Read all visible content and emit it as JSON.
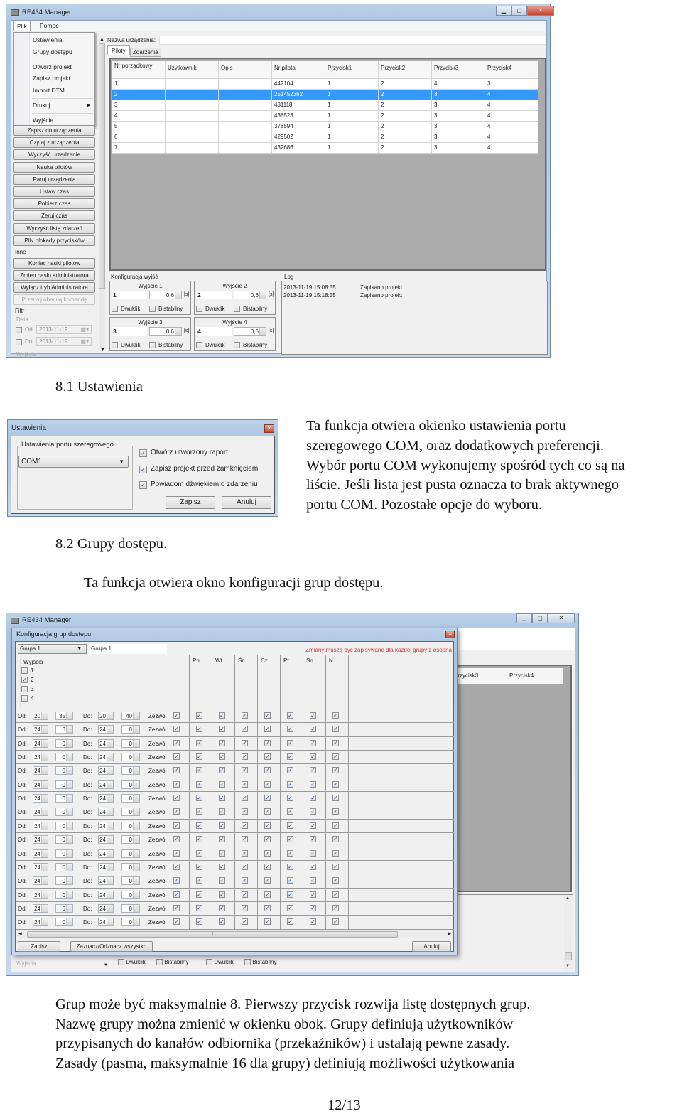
{
  "screen1": {
    "title": "RE434 Manager",
    "menu": [
      "Plik",
      "Pomoc"
    ],
    "dropdown": [
      {
        "label": "Ustawienia"
      },
      {
        "label": "Grupy dostępu"
      },
      {
        "label": "Otworz projekt"
      },
      {
        "label": "Zapisz projekt"
      },
      {
        "label": "Import DTM"
      },
      {
        "label": "Drukuj",
        "submenu": true
      },
      {
        "label": "Wyjście"
      }
    ],
    "left_buttons": [
      "Zapisz do urządzenia",
      "Czytaj z urządzenia",
      "Wyczyść urządzenie",
      "Nauka pilotów",
      "Paruj urządzenia",
      "Ustaw czas",
      "Pobierz czas",
      "Zeruj czas",
      "Wyczyść listę zdarzeń",
      "PIN blokady przycisków"
    ],
    "inne_label": "Inne",
    "inne_buttons": [
      "Koniec nauki pilotów",
      "Zmien hasło administratora",
      "Wyłącz tryb Administratora"
    ],
    "disabled_button": "Przerwij obecną komendę",
    "filter": {
      "label": "Filtr",
      "data_label": "Data",
      "od_label": "Od",
      "od_value": "2013-11-19",
      "do_label": "Do",
      "do_value": "2013-11-19",
      "wyjscia_label": "Wyjścia"
    },
    "device_name_label": "Nazwa urządzenia:",
    "device_name_value": "",
    "tabs": [
      "Piloty",
      "Zdarzenia"
    ],
    "active_tab": "Piloty",
    "grid": {
      "headers": [
        "Nr porządkowy",
        "Użytkownik",
        "Opis",
        "Nr pilota",
        "Przycisk1",
        "Przycisk2",
        "Przycisk3",
        "Przycisk4"
      ],
      "selected_row": 2,
      "rows": [
        [
          "1",
          "",
          "",
          "442104",
          "1",
          "2",
          "4",
          "3"
        ],
        [
          "2",
          "",
          "",
          "251452362",
          "1",
          "2",
          "3",
          "4"
        ],
        [
          "3",
          "",
          "",
          "431118",
          "1",
          "2",
          "3",
          "4"
        ],
        [
          "4",
          "",
          "",
          "438523",
          "1",
          "2",
          "3",
          "4"
        ],
        [
          "5",
          "",
          "",
          "378594",
          "1",
          "2",
          "3",
          "4"
        ],
        [
          "6",
          "",
          "",
          "429502",
          "1",
          "2",
          "3",
          "4"
        ],
        [
          "7",
          "",
          "",
          "432686",
          "1",
          "2",
          "3",
          "4"
        ]
      ]
    },
    "outputs_label": "Konfiguracja wyjść",
    "outputs": [
      {
        "title": "Wyjście 1",
        "value": "1",
        "time": "0,6",
        "unit": "[s]",
        "dwuklik": "Dwuklik",
        "bistabilny": "Bistabilny"
      },
      {
        "title": "Wyjście 2",
        "value": "2",
        "time": "0,6",
        "unit": "[s]",
        "dwuklik": "Dwuklik",
        "bistabilny": "Bistabilny"
      },
      {
        "title": "Wyjście 3",
        "value": "3",
        "time": "0,6",
        "unit": "[s]",
        "dwuklik": "Dwuklik",
        "bistabilny": "Bistabilny"
      },
      {
        "title": "Wyjście 4",
        "value": "4",
        "time": "0,6",
        "unit": "[s]",
        "dwuklik": "Dwuklik",
        "bistabilny": "Bistabilny"
      }
    ],
    "log_label": "Log",
    "log": [
      {
        "time": "2013-11-19 15:08:55",
        "msg": "Zapisano projekt"
      },
      {
        "time": "2013-11-19 15:18:55",
        "msg": "Zapisano projekt"
      }
    ]
  },
  "section1": {
    "heading": "8.1 Ustawienia",
    "paragraph": [
      "Ta funkcja otwiera okienko ustawienia portu",
      "szeregowego COM, oraz dodatkowych preferencji.",
      "Wybór portu COM wykonujemy spośród tych co są na",
      "liście. Jeśli lista jest pusta oznacza to brak aktywnego",
      "portu COM. Pozostałe opcje do wyboru."
    ]
  },
  "settings_dialog": {
    "title": "Ustawienia",
    "port_group": "Ustawienia portu szeregowego",
    "port_value": "COM1",
    "options": [
      {
        "label": "Otwórz utworzony raport",
        "checked": true
      },
      {
        "label": "Zapisz projekt przed zamknięciem",
        "checked": true
      },
      {
        "label": "Powiadom dźwiękiem o zdarzeniu",
        "checked": true
      }
    ],
    "save": "Zapisz",
    "cancel": "Anuluj"
  },
  "section2": {
    "heading": "8.2 Grupy dostępu.",
    "intro": "Ta funkcja otwiera okno konfiguracji grup dostępu."
  },
  "screen2": {
    "title": "RE434 Manager",
    "bg_headers": [
      "Przycisk3",
      "Przycisk4"
    ],
    "bg_wyjscia": "Wyjścia",
    "bg_dwuklik": "Dwuklik",
    "bg_bistabilny": "Bistabilny",
    "dialog": {
      "title": "Konfiguracja grup dostepu",
      "group_select": "Grupa 1",
      "group_name": "Grupa 1",
      "notice": "Zmiany muszą być zapisywane dla każdej grupy z osobna",
      "notice_color": "#d0393b",
      "outputs_label": "Wyjścia",
      "outputs": [
        {
          "label": "1",
          "checked": false
        },
        {
          "label": "2",
          "checked": true
        },
        {
          "label": "3",
          "checked": false
        },
        {
          "label": "4",
          "checked": false
        }
      ],
      "days": [
        "Pn",
        "Wt",
        "Śr",
        "Cz",
        "Pt",
        "So",
        "N"
      ],
      "od_label": "Od:",
      "do_label": "Do:",
      "allow_label": "Zezwól",
      "rows": [
        {
          "od_h": "20",
          "od_m": "35",
          "do_h": "20",
          "do_m": "40"
        },
        {
          "od_h": "24",
          "od_m": "0",
          "do_h": "24",
          "do_m": "0"
        },
        {
          "od_h": "24",
          "od_m": "0",
          "do_h": "24",
          "do_m": "0"
        },
        {
          "od_h": "24",
          "od_m": "0",
          "do_h": "24",
          "do_m": "0"
        },
        {
          "od_h": "24",
          "od_m": "0",
          "do_h": "24",
          "do_m": "0"
        },
        {
          "od_h": "24",
          "od_m": "0",
          "do_h": "24",
          "do_m": "0"
        },
        {
          "od_h": "24",
          "od_m": "0",
          "do_h": "24",
          "do_m": "0"
        },
        {
          "od_h": "24",
          "od_m": "0",
          "do_h": "24",
          "do_m": "0"
        },
        {
          "od_h": "24",
          "od_m": "0",
          "do_h": "24",
          "do_m": "0"
        },
        {
          "od_h": "24",
          "od_m": "0",
          "do_h": "24",
          "do_m": "0"
        },
        {
          "od_h": "24",
          "od_m": "0",
          "do_h": "24",
          "do_m": "0"
        },
        {
          "od_h": "24",
          "od_m": "0",
          "do_h": "24",
          "do_m": "0"
        },
        {
          "od_h": "24",
          "od_m": "0",
          "do_h": "24",
          "do_m": "0"
        },
        {
          "od_h": "24",
          "od_m": "0",
          "do_h": "24",
          "do_m": "0"
        },
        {
          "od_h": "24",
          "od_m": "0",
          "do_h": "24",
          "do_m": "0"
        },
        {
          "od_h": "24",
          "od_m": "0",
          "do_h": "24",
          "do_m": "0"
        }
      ],
      "save": "Zapisz",
      "toggle_all": "Zaznacz/Odznacz wszystko",
      "cancel": "Anuluj"
    }
  },
  "section3": {
    "paragraph": [
      "Grup może być maksymalnie 8. Pierwszy przycisk rozwija listę dostępnych grup.",
      "Nazwę grupy można zmienić w okienku obok. Grupy definiują użytkowników",
      "przypisanych do kanałów odbiornika (przekaźników) i ustalają pewne zasady.",
      "Zasady (pasma, maksymalnie 16 dla grupy) definiują możliwości użytkowania"
    ]
  },
  "footer": {
    "page": "12/13"
  }
}
